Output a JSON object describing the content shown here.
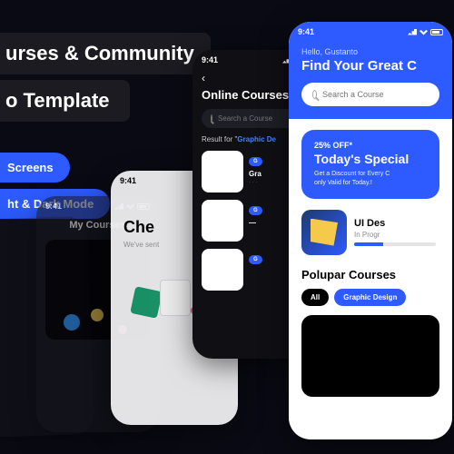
{
  "titles": {
    "line1": "urses & Community",
    "line2": "o Template"
  },
  "badges": {
    "b1": "Screens",
    "b2": "ht & Dark Mode"
  },
  "time": "9:41",
  "p2": {
    "header": "My Courses"
  },
  "p3": {
    "heading": "Che",
    "sub": "We've sent"
  },
  "p4": {
    "title": "Online Courses",
    "search_ph": "Search a Course",
    "result_prefix": "Result for \"",
    "result_term": "Graphic De",
    "chip": "G",
    "course_title": "Gra"
  },
  "p5": {
    "hello": "Hello, Gustanto",
    "find": "Find Your Great C",
    "search_ph": "Search a Course",
    "promo_off": "25% OFF*",
    "promo_deal": "Today's Special",
    "promo_desc1": "Get a Discount for Every C",
    "promo_desc2": "only Valid for Today.!",
    "course_name": "UI Des",
    "course_prog": "In Progr",
    "popular": "Polupar Courses",
    "pill_all": "All",
    "pill_gd": "Graphic Design"
  }
}
